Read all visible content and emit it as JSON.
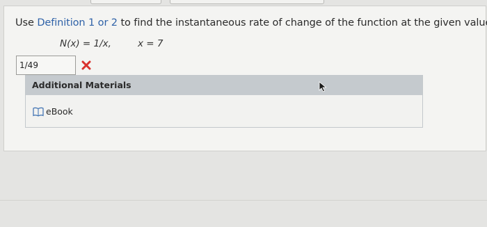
{
  "question": {
    "prefix": "Use ",
    "link_text": "Definition 1 or 2",
    "suffix": " to find the instantaneous rate of change of the function at the given value."
  },
  "formula": {
    "function": "N(x) = 1/x,",
    "value": "x = 7"
  },
  "answer": {
    "value": "1/49",
    "status_icon": "red-x-icon"
  },
  "additional_materials": {
    "header": "Additional Materials",
    "items": [
      {
        "label": "eBook",
        "icon": "book-icon"
      }
    ]
  },
  "colors": {
    "link": "#2f62a8",
    "wrong_mark": "#d9312d",
    "materials_header": "#c5cace"
  }
}
